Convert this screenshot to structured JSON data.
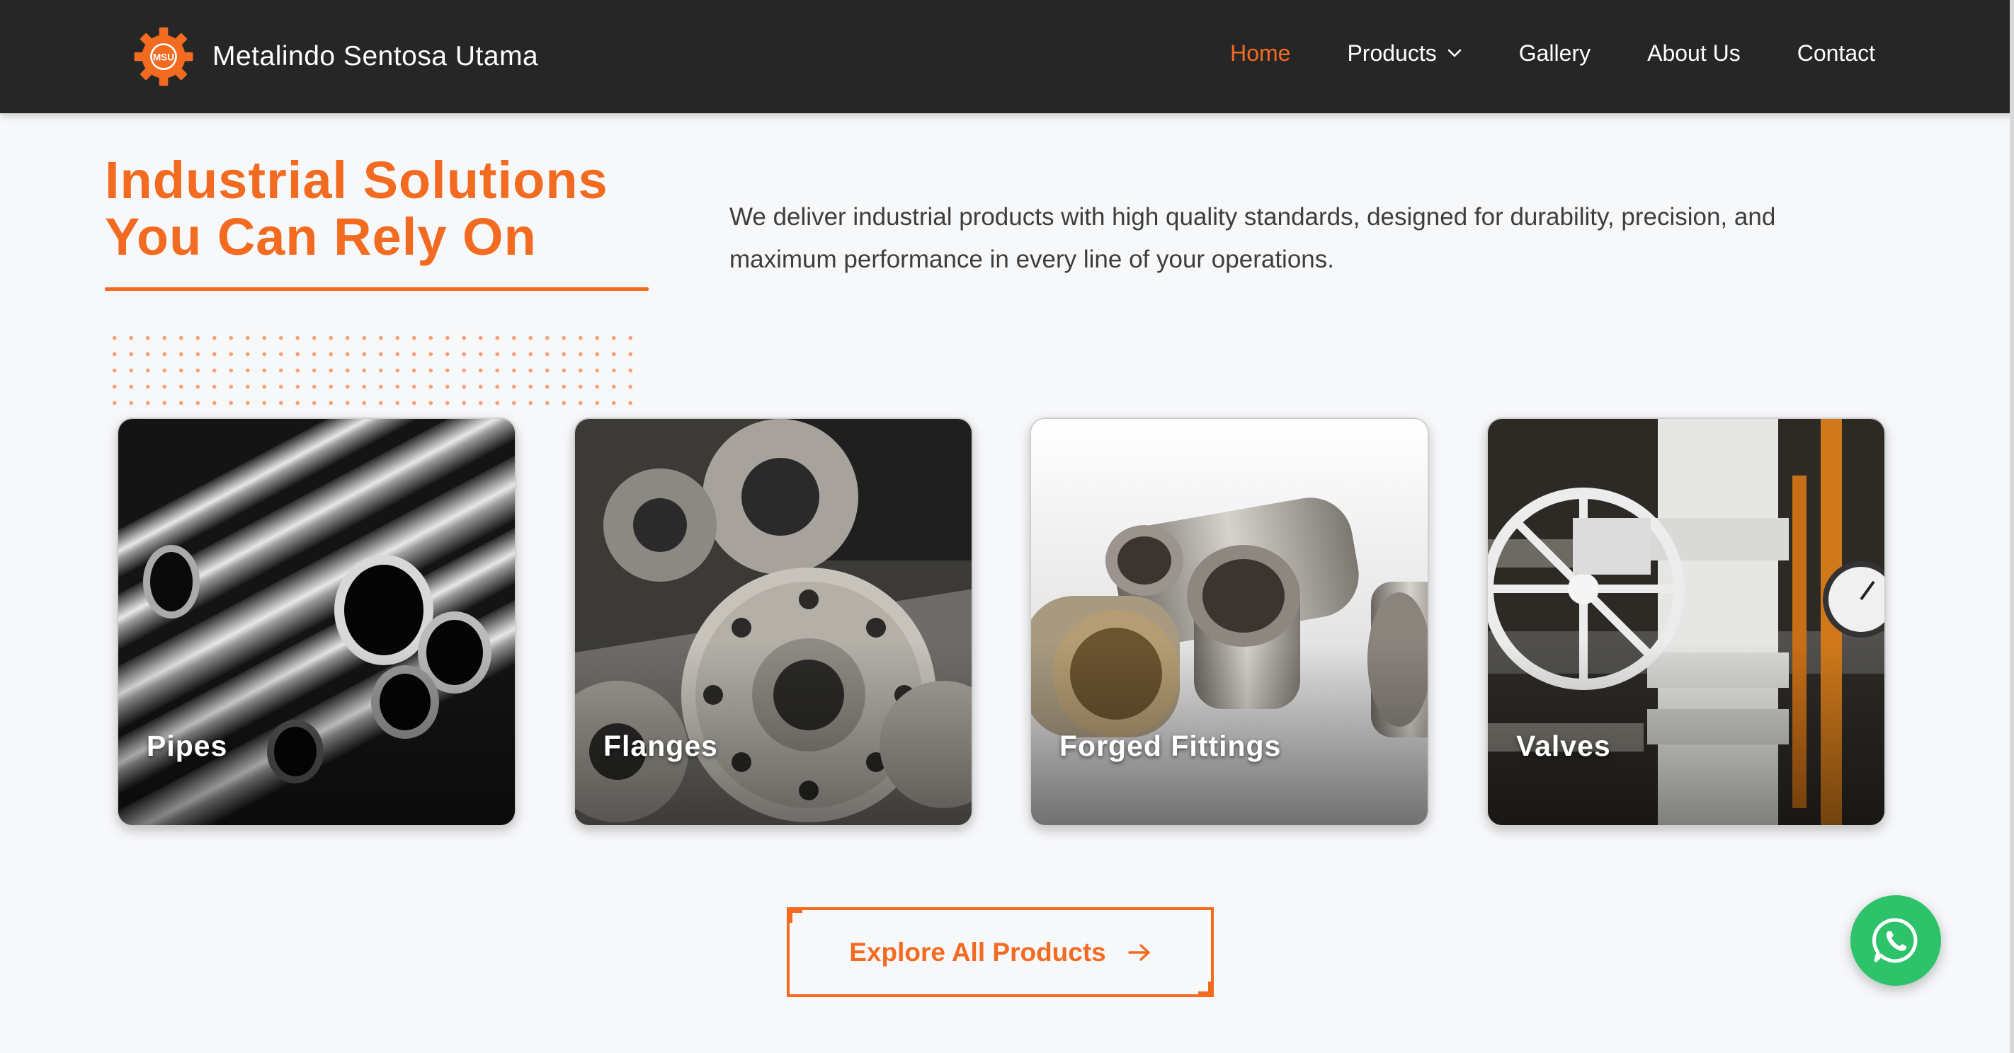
{
  "header": {
    "brand_name": "Metalindo Sentosa Utama",
    "logo_text": "MSU",
    "nav": [
      {
        "label": "Home",
        "active": true
      },
      {
        "label": "Products",
        "has_dropdown": true
      },
      {
        "label": "Gallery"
      },
      {
        "label": "About Us"
      },
      {
        "label": "Contact"
      }
    ]
  },
  "hero": {
    "title_line1": "Industrial Solutions",
    "title_line2": "You Can Rely On",
    "description": "We deliver industrial products with high quality standards, designed for durability, precision, and maximum performance in every line of your operations."
  },
  "products": [
    {
      "label": "Pipes"
    },
    {
      "label": "Flanges"
    },
    {
      "label": "Forged Fittings"
    },
    {
      "label": "Valves"
    }
  ],
  "cta": {
    "label": "Explore All Products"
  },
  "colors": {
    "accent": "#f26b21",
    "header_bg": "#262626",
    "page_bg": "#f7f8fa",
    "whatsapp": "#2ec36b"
  },
  "icons": {
    "logo": "gear-logo-icon",
    "dropdown": "chevron-down-icon",
    "cta": "arrow-right-icon",
    "chat": "whatsapp-icon"
  }
}
